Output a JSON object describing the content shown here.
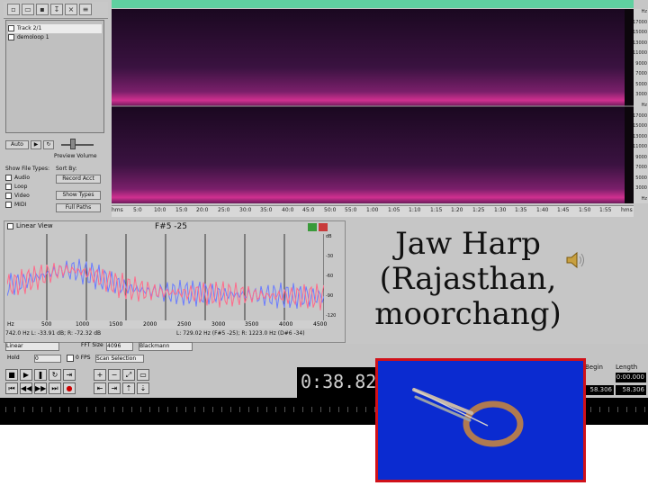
{
  "app": {
    "files": [
      {
        "label": "Track 2/1",
        "selected": true
      },
      {
        "label": "demoloop 1"
      }
    ],
    "auto_play_label": "Auto",
    "preview_volume_label": "Preview Volume",
    "show_file_types_label": "Show File Types:",
    "sort_by_label": "Sort By:",
    "file_types": [
      "Audio",
      "Loop",
      "Video",
      "MIDI"
    ],
    "sort_value": "Record Acct",
    "show_all_label": "Show Types",
    "full_paths_label": "Full Paths",
    "ruler_labels": [
      "hms",
      "5:0",
      "10:0",
      "15:0",
      "20:0",
      "25:0",
      "30:0",
      "35:0",
      "40:0",
      "45:0",
      "50:0",
      "55:0",
      "1:00",
      "1:05",
      "1:10",
      "1:15",
      "1:20",
      "1:25",
      "1:30",
      "1:35",
      "1:40",
      "1:45",
      "1:50",
      "1:55",
      "hms"
    ],
    "freq_labels": [
      "Hz",
      "17000",
      "15000",
      "13000",
      "11000",
      "9000",
      "7000",
      "5000",
      "3000",
      "Hz",
      "17000",
      "15000",
      "13000",
      "11000",
      "9000",
      "7000",
      "5000",
      "3000",
      "Hz"
    ]
  },
  "freq_analysis": {
    "view_mode": "Linear View",
    "note_readout": "F#5 -25",
    "x_axis_labels": [
      "Hz",
      "500",
      "1000",
      "1500",
      "2000",
      "2500",
      "3000",
      "3500",
      "4000",
      "4500"
    ],
    "y_axis_labels": [
      "dB",
      "-30",
      "-60",
      "-90",
      "-120"
    ],
    "cursor_left": "742.0 Hz L: -33.91 dB; R: -72.32 dB",
    "cursor_right": "L: 729.02 Hz (F#5 -25); R: 1223.0 Hz (D#6 -34)",
    "fft_label": "Linear",
    "fft_size_label": "FFT Size",
    "fft_size_value": "4096",
    "window_label": "Blackmann",
    "hold_label": "Hold",
    "hold_value": "0",
    "fps_label": "0 FPS",
    "scan_label": "Scan Selection"
  },
  "transport": {
    "time": "0:38.82",
    "begin_label": "Begin",
    "end_label": "Length",
    "begin_value": "58.306",
    "end_value": "0:00.000",
    "length_value": "58.306"
  },
  "overlay": {
    "caption_lines": [
      "Jaw Harp",
      "(Rajasthan,",
      "moorchang)"
    ],
    "speaker_icon": "speaker-icon",
    "photo_subject": "jaw-harp-photo"
  },
  "colors": {
    "accent_green": "#5fd0a0",
    "photo_bg": "#0b2bd0",
    "photo_border": "#d0111a"
  }
}
